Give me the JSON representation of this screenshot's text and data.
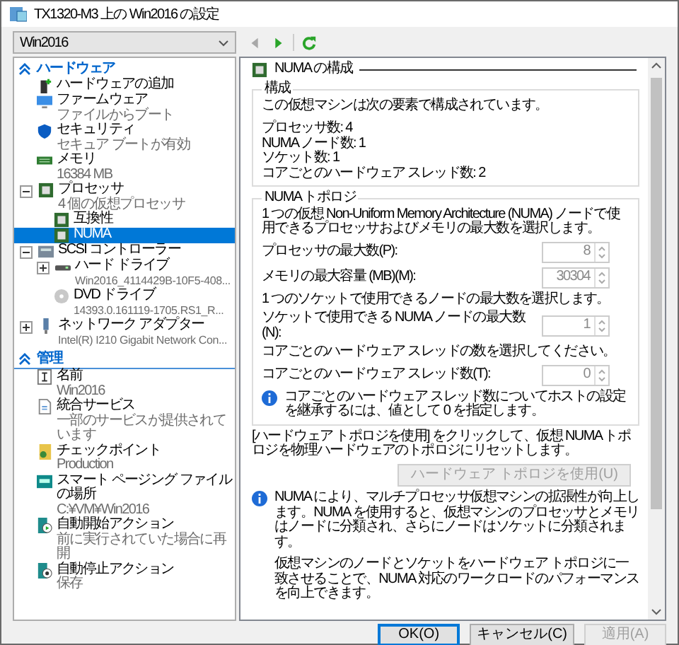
{
  "window": {
    "title": "TX1320-M3 上の Win2016 の設定"
  },
  "vm_selector": {
    "value": "Win2016"
  },
  "tree": [
    {
      "label": "ハードウェア",
      "expanded": true,
      "items": [
        {
          "kind": "add",
          "label": "ハードウェアの追加",
          "selected": false
        },
        {
          "kind": "firmware",
          "label": "ファームウェア",
          "detail": "ファイルからブート",
          "selected": false
        },
        {
          "kind": "security",
          "label": "セキュリティ",
          "detail": "セキュア ブートが有効",
          "selected": false
        },
        {
          "kind": "memory",
          "label": "メモリ",
          "detail": "16384 MB",
          "selected": false
        },
        {
          "kind": "processor",
          "label": "プロセッサ",
          "detail": "4 個の仮想プロセッサ",
          "selected": false,
          "expanded": true,
          "children": [
            {
              "kind": "processor",
              "label": "互換性",
              "selected": false
            },
            {
              "kind": "processor",
              "label": "NUMA",
              "selected": true
            }
          ]
        },
        {
          "kind": "controller",
          "label": "SCSI コントローラー",
          "selected": false,
          "expanded": true,
          "children": [
            {
              "kind": "disk",
              "label": "ハード ドライブ",
              "detail": "Win2016_4114429B-10F5-408...",
              "selected": false,
              "expanded": false
            },
            {
              "kind": "dvd",
              "label": "DVD ドライブ",
              "detail": "14393.0.161119-1705.RS1_R...",
              "selected": false
            }
          ]
        },
        {
          "kind": "network",
          "label": "ネットワーク アダプター",
          "detail": "Intel(R) I210 Gigabit Network Con...",
          "selected": false,
          "expanded": false
        }
      ]
    },
    {
      "label": "管理",
      "expanded": true,
      "items": [
        {
          "kind": "name",
          "label": "名前",
          "detail": "Win2016",
          "selected": false
        },
        {
          "kind": "service",
          "label": "統合サービス",
          "detail": "一部のサービスが提供されています",
          "selected": false
        },
        {
          "kind": "checkpoint",
          "label": "チェックポイント",
          "detail": "Production",
          "selected": false
        },
        {
          "kind": "paging",
          "label": "スマート ページング ファイルの場所",
          "detail": "C:¥VM¥Win2016",
          "selected": false
        },
        {
          "kind": "start",
          "label": "自動開始アクション",
          "detail": "前に実行されていた場合に再開",
          "selected": false
        },
        {
          "kind": "stop",
          "label": "自動停止アクション",
          "detail": "保存",
          "selected": false
        }
      ]
    }
  ],
  "nav": [
    {
      "kind": "back",
      "disabled": true
    },
    {
      "kind": "forward",
      "disabled": false
    },
    {
      "kind": "refresh",
      "disabled": false
    }
  ],
  "pane": {
    "title": "NUMA の構成",
    "groups": [
      {
        "legend": "構成",
        "rows": [
          {
            "kind": "text",
            "text": "この仮想マシンは次の要素で構成されています。"
          },
          {
            "kind": "list",
            "lines": [
              "プロセッサ数: 4",
              "NUMA ノード数: 1",
              "ソケット数: 1",
              "コアごとのハードウェア スレッド数: 2"
            ]
          }
        ]
      },
      {
        "legend": "NUMA トポロジ",
        "rows": [
          {
            "kind": "text",
            "text": "1 つの仮想 Non-Uniform Memory Architecture (NUMA) ノードで使用できるプロセッサおよびメモリの最大数を選択します。"
          },
          {
            "kind": "spin",
            "label": "プロセッサの最大数(P):",
            "value": "8",
            "disabled": true
          },
          {
            "kind": "spin",
            "label": "メモリの最大容量 (MB)(M):",
            "value": "30304",
            "disabled": true
          },
          {
            "kind": "text",
            "text": "1 つのソケットで使用できるノードの最大数を選択します。"
          },
          {
            "kind": "spin",
            "label": "ソケットで使用できる NUMA ノードの最大数(N):",
            "value": "1",
            "disabled": true
          },
          {
            "kind": "text",
            "text": "コアごとのハードウェア スレッドの数を選択してください。"
          },
          {
            "kind": "spin",
            "label": "コアごとのハードウェア スレッド数(T):",
            "value": "0",
            "disabled": true
          },
          {
            "kind": "info",
            "paragraphs": [
              "コアごとのハードウェア スレッド数についてホストの設定を継承するには、値として 0 を指定します。"
            ]
          }
        ]
      }
    ],
    "rows": [
      {
        "kind": "text",
        "text": "[ハードウェア トポロジを使用] をクリックして、仮想 NUMA トポロジを物理ハードウェアのトポロジにリセットします。"
      },
      {
        "kind": "button",
        "label": "ハードウェア トポロジを使用(U)",
        "disabled": true
      },
      {
        "kind": "info",
        "paragraphs": [
          "NUMA により、マルチプロセッサ仮想マシンの拡張性が向上します。NUMA を使用すると、仮想マシンのプロセッサとメモリはノードに分類され、さらにノードはソケットに分類されます。",
          "仮想マシンのノードとソケットをハードウェア トポロジに一致させることで、NUMA 対応のワークロードのパフォーマンスを向上できます。"
        ]
      }
    ]
  },
  "buttons": [
    {
      "label": "OK(O)",
      "default": true,
      "disabled": false
    },
    {
      "label": "キャンセル(C)",
      "default": false,
      "disabled": false
    },
    {
      "label": "適用(A)",
      "default": false,
      "disabled": true
    }
  ]
}
